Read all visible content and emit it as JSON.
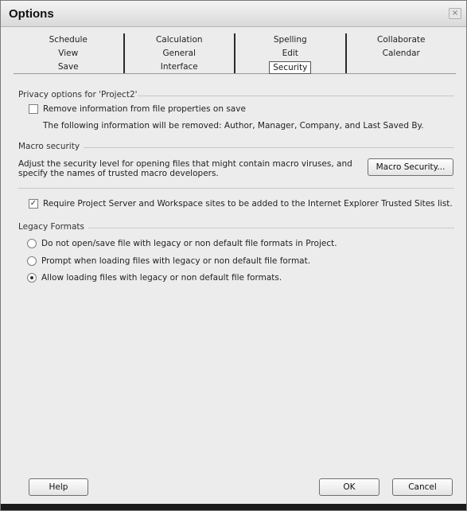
{
  "window": {
    "title": "Options",
    "close_glyph": "×"
  },
  "tabs": {
    "row1": [
      "Schedule",
      "Calculation",
      "Spelling",
      "Collaborate"
    ],
    "row2": [
      "View",
      "General",
      "Edit",
      "Calendar"
    ],
    "row3": [
      "Save",
      "Interface",
      "Security",
      ""
    ]
  },
  "privacy": {
    "heading": "Privacy options for 'Project2'",
    "remove_info_label": "Remove information from file properties on save",
    "remove_info_checked": false,
    "removed_note": "The following information will be removed: Author, Manager, Company, and Last Saved By."
  },
  "macro": {
    "heading": "Macro security",
    "desc_line1": "Adjust the security level for opening files that might contain macro viruses, and",
    "desc_line2": "specify the names of trusted macro developers.",
    "button_label": "Macro Security..."
  },
  "trusted": {
    "label": "Require Project Server and Workspace sites to be added to the Internet Explorer Trusted Sites list.",
    "checked": true
  },
  "legacy": {
    "heading": "Legacy Formats",
    "options": [
      {
        "label": "Do not open/save file with legacy or non default file formats in Project.",
        "selected": false
      },
      {
        "label": "Prompt when loading files with legacy or non default file format.",
        "selected": false
      },
      {
        "label": "Allow loading files with legacy or non default file formats.",
        "selected": true
      }
    ]
  },
  "footer": {
    "help_label": "Help",
    "ok_label": "OK",
    "cancel_label": "Cancel"
  }
}
